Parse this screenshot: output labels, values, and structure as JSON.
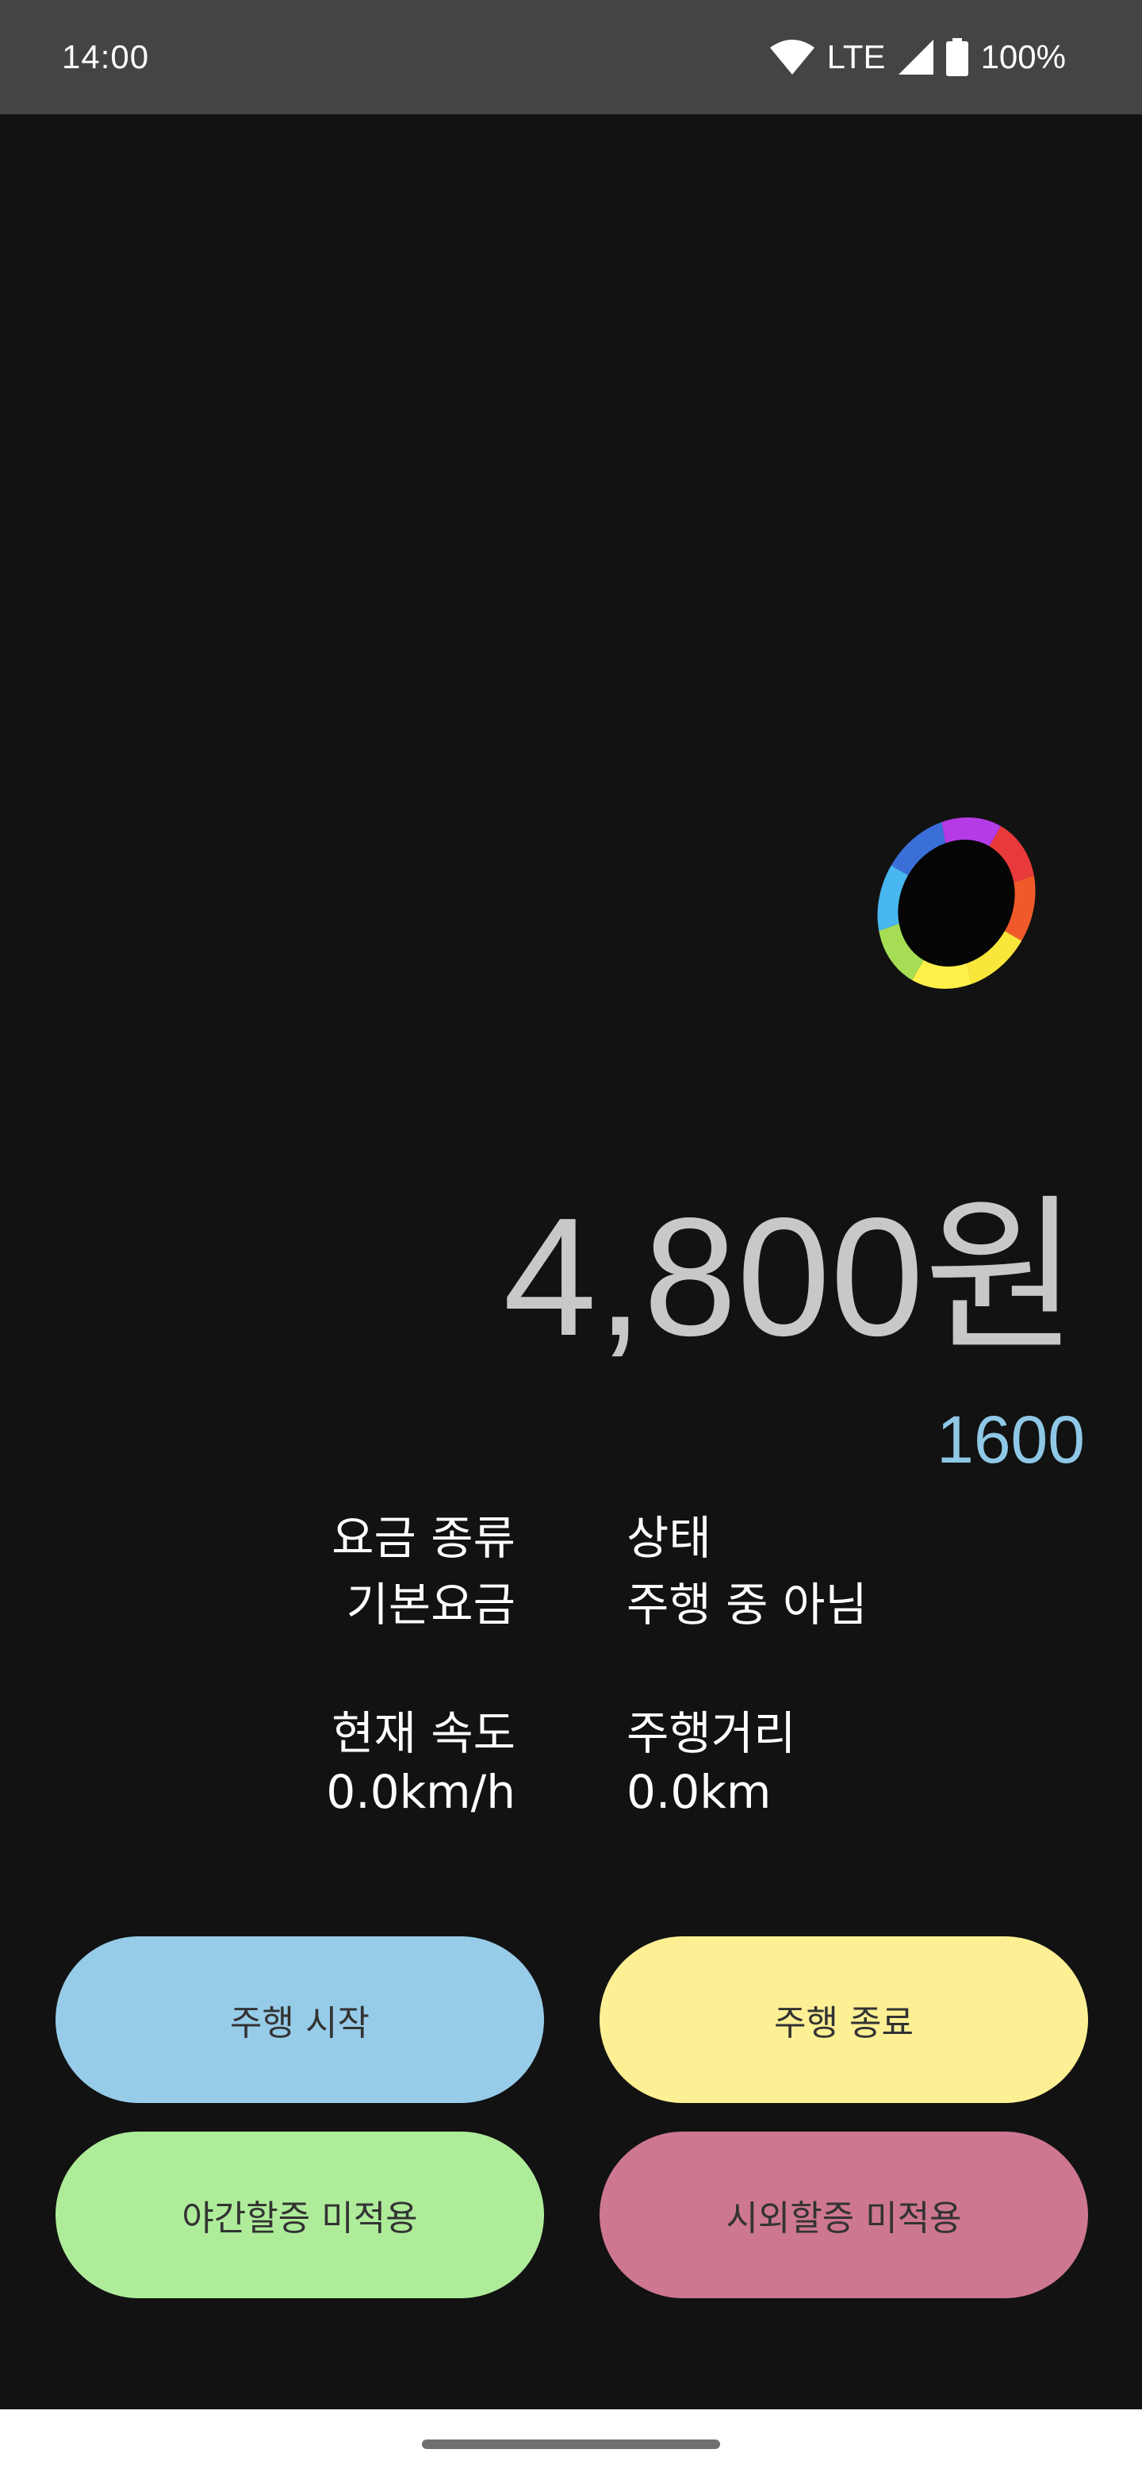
{
  "status_bar": {
    "time": "14:00",
    "network": "LTE",
    "battery": "100%",
    "icons": [
      "wifi-icon",
      "cell-signal-icon",
      "battery-icon"
    ]
  },
  "fare": {
    "amount": "4,800원",
    "base_unit": "1600"
  },
  "info": {
    "fare_type_label": "요금 종류",
    "fare_type_value": "기본요금",
    "status_label": "상태",
    "status_value": "주행 중 아님",
    "speed_label": "현재 속도",
    "speed_value": "0.0km/h",
    "distance_label": "주행거리",
    "distance_value": "0.0km"
  },
  "buttons": {
    "start": "주행 시작",
    "stop": "주행 종료",
    "night_surcharge": "야간할증 미적용",
    "suburb_surcharge": "시외할증 미적용"
  },
  "colors": {
    "status_bar_bg": "#444444",
    "screen_bg": "#121212",
    "fare_text": "#c8c8c8",
    "unit_text": "#8fc8e6",
    "start_button": "#97cce9",
    "stop_button": "#fdf094",
    "night_button": "#aeec9a",
    "suburb_button": "#cd7790"
  }
}
